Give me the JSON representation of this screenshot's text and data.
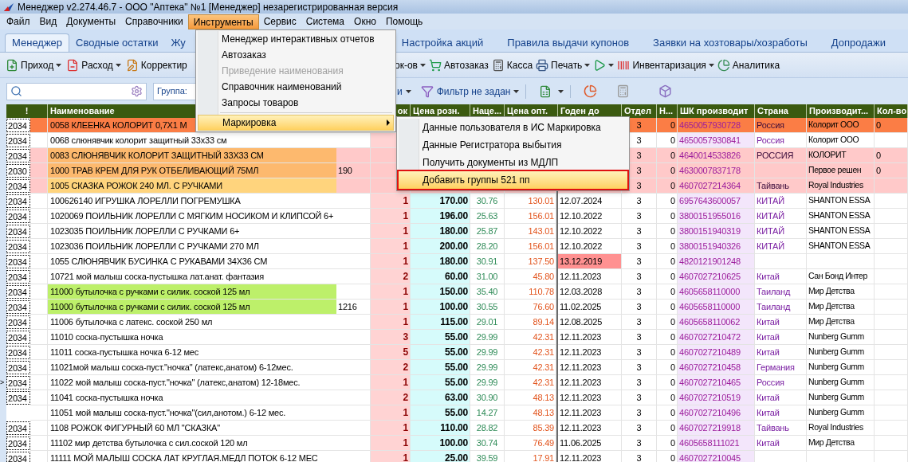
{
  "window": {
    "title": "Менеджер v2.274.46.7 - ООО \"Аптека\" №1 [Менеджер] незарегистрированная версия"
  },
  "menu_bar": [
    {
      "label": "Файл",
      "selected": false
    },
    {
      "label": "Вид",
      "selected": false
    },
    {
      "label": "Документы",
      "selected": false
    },
    {
      "label": "Справочники",
      "selected": false
    },
    {
      "label": "Инструменты",
      "selected": true
    },
    {
      "label": "Сервис",
      "selected": false
    },
    {
      "label": "Система",
      "selected": false
    },
    {
      "label": "Окно",
      "selected": false
    },
    {
      "label": "Помощь",
      "selected": false
    }
  ],
  "tabs_left": [
    {
      "label": "Менеджер",
      "selected": true
    },
    {
      "label": "Сводные остатки",
      "selected": false
    },
    {
      "label": "Жу",
      "selected": false
    }
  ],
  "tabs_right": [
    {
      "label": "Настройка акций",
      "selected": false
    },
    {
      "label": "Правила выдачи купонов",
      "selected": false
    },
    {
      "label": "Заявки на хозтовары/хозработы",
      "selected": false
    },
    {
      "label": "Допродажи",
      "selected": false
    }
  ],
  "toolbar_left": [
    {
      "label": "Приход",
      "dropdown": true
    },
    {
      "label": "Расход",
      "dropdown": true
    },
    {
      "label": "Корректир",
      "dropdown": false
    }
  ],
  "toolbar_right": [
    {
      "label": "ок-ов",
      "dropdown": true
    },
    {
      "label": "Автозаказ",
      "dropdown": false
    },
    {
      "label": "Касса",
      "dropdown": false
    },
    {
      "label": "Печать",
      "dropdown": true
    },
    {
      "dropdown": true
    },
    {
      "label": "Инвентаризация",
      "dropdown": true
    },
    {
      "label": "Аналитика",
      "dropdown": false
    }
  ],
  "filter_bar": {
    "group_label": "Группа:",
    "partial_label": "и",
    "filter_label": "Фильтр не задан"
  },
  "table": {
    "columns": [
      "!",
      "Наименование",
      "ок",
      "Цена розн.",
      "Наце...",
      "Цена опт.",
      "Годен до",
      "Отдел",
      "Н...",
      "ШК производит",
      "Страна",
      "Производит...",
      "Кол-во"
    ],
    "rows": [
      {
        "code": "2034",
        "name": {
          "text": "0058 КЛЕЕНКА КОЛОРИТ 0,7Х1 М"
        },
        "color": "#fb7d45",
        "dept": "3",
        "n": "0",
        "barcode": "4650057930728",
        "country": "Россия",
        "maker": "Колорит ООО",
        "qty": "0"
      },
      {
        "code": "2034",
        "name": {
          "text": "0068 слюнявчик колорит защитный 33х33 см"
        },
        "dept": "3",
        "n": "0",
        "barcode": "4650057930841",
        "country": "Россия",
        "maker": "Колорит ООО"
      },
      {
        "code": "2034",
        "name": {
          "text": "0083 СЛЮНЯВЧИК КОЛОРИТ ЗАЩИТНЫЙ 33Х33 СМ",
          "color": "#fdb96e"
        },
        "color": "#ffc9c9",
        "dept": "3",
        "n": "0",
        "barcode": "4640014533826",
        "country": "РОССИЯ",
        "maker": "КОЛОРИТ",
        "qty": "0"
      },
      {
        "code": "2030",
        "name": {
          "text": "1000 ТРАВ КРЕМ ДЛЯ РУК ОТБЕЛИВАЮЩИЙ 75МЛ",
          "color": "#fdb96e"
        },
        "column_3": "190",
        "color": "#ffc9c9",
        "dept": "3",
        "n": "0",
        "barcode": "4630007837178",
        "maker": "Первое решен",
        "qty": "0"
      },
      {
        "code": "2034",
        "name": {
          "text": "1005 СКАЗКА РОЖОК 240 МЛ. С РУЧКАМИ",
          "color": "#ffd47d"
        },
        "color": "#ffc9c9",
        "dept": "3",
        "n": "0",
        "barcode": "4607027214364",
        "country": "Тайвань",
        "maker": "Royal Industries"
      },
      {
        "code": "2034",
        "name": {
          "text": "100626140 ИГРУШКА ЛОРЕЛЛИ ПОГРЕМУШКА"
        },
        "stock": "1",
        "retail": "170.00",
        "markup": "30.76",
        "wholesale": "130.01",
        "expiry": "12.07.2024",
        "expired": false,
        "dept": "3",
        "n": "0",
        "barcode": "6957643600057",
        "country": "КИТАЙ",
        "maker": "SHANTON ESSA"
      },
      {
        "code": "2034",
        "name": {
          "text": "1020069 ПОИЛЬНИК ЛОРЕЛЛИ С МЯГКИМ НОСИКОМ И КЛИПСОЙ 6+"
        },
        "stock": "1",
        "retail": "196.00",
        "markup": "25.63",
        "wholesale": "156.01",
        "expiry": "12.10.2022",
        "expired": false,
        "dept": "3",
        "n": "0",
        "barcode": "3800151955016",
        "country": "КИТАЙ",
        "maker": "SHANTON ESSA"
      },
      {
        "code": "2034",
        "name": {
          "text": "1023035 ПОИЛЬНИК ЛОРЕЛЛИ С РУЧКАМИ 6+"
        },
        "stock": "1",
        "retail": "180.00",
        "markup": "25.87",
        "wholesale": "143.01",
        "expiry": "12.10.2022",
        "expired": false,
        "dept": "3",
        "n": "0",
        "barcode": "3800151940319",
        "country": "КИТАЙ",
        "maker": "SHANTON ESSA"
      },
      {
        "code": "2034",
        "name": {
          "text": "1023036 ПОИЛЬНИК ЛОРЕЛЛИ С РУЧКАМИ 270 МЛ"
        },
        "stock": "1",
        "retail": "200.00",
        "markup": "28.20",
        "wholesale": "156.01",
        "expiry": "12.10.2022",
        "expired": false,
        "dept": "3",
        "n": "0",
        "barcode": "3800151940326",
        "country": "КИТАЙ",
        "maker": "SHANTON ESSA"
      },
      {
        "code": "2034",
        "name": {
          "text": "1055 СЛЮНЯВЧИК БУСИНКА С РУКАВАМИ 34Х36 СМ"
        },
        "stock": "1",
        "retail": "180.00",
        "markup": "30.91",
        "wholesale": "137.50",
        "expiry": "13.12.2019",
        "expired": true,
        "dept": "3",
        "n": "0",
        "barcode": "4820121901248"
      },
      {
        "code": "2034",
        "name": {
          "text": "10721 мой малыш соска-пустышка лат.анат. фантазия"
        },
        "stock": "2",
        "retail": "60.00",
        "markup": "31.00",
        "wholesale": "45.80",
        "expiry": "12.11.2023",
        "expired": false,
        "dept": "3",
        "n": "0",
        "barcode": "4607027210625",
        "country": "Китай",
        "maker": "Сан Бонд Интер"
      },
      {
        "code": "2034",
        "name": {
          "text": "11000 бутылочка с ручками с силик. соской 125 мл",
          "color": "#bdf06a"
        },
        "stock": "1",
        "retail": "150.00",
        "markup": "35.40",
        "wholesale": "110.78",
        "expiry": "12.03.2028",
        "expired": false,
        "dept": "3",
        "n": "0",
        "barcode": "4605658110000",
        "country": "Таиланд",
        "maker": "Мир Детства"
      },
      {
        "code": "2034",
        "name": {
          "text": "11000 бутылочка с ручками с силик. соской 125 мл",
          "color": "#bdf06a"
        },
        "column_3": "1216",
        "stock": "1",
        "retail": "100.00",
        "markup": "30.55",
        "wholesale": "76.60",
        "expiry": "11.02.2025",
        "expired": false,
        "dept": "3",
        "n": "0",
        "barcode": "4605658110000",
        "country": "Таиланд",
        "maker": "Мир Детства"
      },
      {
        "code": "2034",
        "name": {
          "text": "11006 бутылочка с латекс. соской 250 мл"
        },
        "stock": "1",
        "retail": "115.00",
        "markup": "29.01",
        "wholesale": "89.14",
        "expiry": "12.08.2025",
        "expired": false,
        "dept": "3",
        "n": "0",
        "barcode": "4605658110062",
        "country": "Китай",
        "maker": "Мир Детства"
      },
      {
        "code": "2034",
        "name": {
          "text": "11010 соска-пустышка ночка"
        },
        "stock": "3",
        "retail": "55.00",
        "markup": "29.99",
        "wholesale": "42.31",
        "expiry": "12.11.2023",
        "expired": false,
        "dept": "3",
        "n": "0",
        "barcode": "4607027210472",
        "country": "Китай",
        "maker": "Nunberg Gumm"
      },
      {
        "code": "2034",
        "name": {
          "text": "11011 соска-пустышка ночка 6-12 мес"
        },
        "stock": "5",
        "retail": "55.00",
        "markup": "29.99",
        "wholesale": "42.31",
        "expiry": "12.11.2023",
        "expired": false,
        "dept": "3",
        "n": "0",
        "barcode": "4607027210489",
        "country": "Китай",
        "maker": "Nunberg Gumm"
      },
      {
        "code": "2034",
        "name": {
          "text": "11021мой малыш соска-пуст.\"ночка\" (латекс,анатом) 6-12мес."
        },
        "stock": "2",
        "retail": "55.00",
        "markup": "29.99",
        "wholesale": "42.31",
        "expiry": "12.11.2023",
        "expired": false,
        "dept": "3",
        "n": "0",
        "barcode": "4607027210458",
        "country": "Германия",
        "maker": "Nunberg Gumm"
      },
      {
        "marker": ">",
        "code": "2034",
        "name": {
          "text": "11022 мой малыш соска-пуст.\"ночка\" (латекс,анатом) 12-18мес."
        },
        "stock": "1",
        "retail": "55.00",
        "markup": "29.99",
        "wholesale": "42.31",
        "expiry": "12.11.2023",
        "expired": false,
        "dept": "3",
        "n": "0",
        "barcode": "4607027210465",
        "country": "Россия",
        "maker": "Nunberg Gumm"
      },
      {
        "code": "2034",
        "name": {
          "text": "11041 соска-пустышка ночка"
        },
        "stock": "2",
        "retail": "63.00",
        "markup": "30.90",
        "wholesale": "48.13",
        "expiry": "12.11.2023",
        "expired": false,
        "dept": "3",
        "n": "0",
        "barcode": "4607027210519",
        "country": "Китай",
        "maker": "Nunberg Gumm"
      },
      {
        "name": {
          "text": "11051 мой малыш соска-пуст.\"ночка\"(сил,анотом.) 6-12 мес."
        },
        "stock": "1",
        "retail": "55.00",
        "markup": "14.27",
        "wholesale": "48.13",
        "expiry": "12.11.2023",
        "expired": false,
        "dept": "3",
        "n": "0",
        "barcode": "4607027210496",
        "country": "Китай",
        "maker": "Nunberg Gumm"
      },
      {
        "code": "2034",
        "name": {
          "text": "1108 РОЖОК ФИГУРНЫЙ 60 МЛ \"СКАЗКА\""
        },
        "stock": "1",
        "retail": "110.00",
        "markup": "28.82",
        "wholesale": "85.39",
        "expiry": "12.11.2023",
        "expired": false,
        "dept": "3",
        "n": "0",
        "barcode": "4607027219918",
        "country": "Тайвань",
        "maker": "Royal Industries"
      },
      {
        "code": "2034",
        "name": {
          "text": "11102 мир детства бутылочка с сил.соской 120 мл"
        },
        "stock": "1",
        "retail": "100.00",
        "markup": "30.74",
        "wholesale": "76.49",
        "expiry": "11.06.2025",
        "expired": false,
        "dept": "3",
        "n": "0",
        "barcode": "4605658111021",
        "country": "Китай",
        "maker": "Мир Детства"
      },
      {
        "code": "2034",
        "name": {
          "text": "11111 МОЙ МАЛЫШ СОСКА ЛАТ КРУГЛАЯ.МЕДЛ ПОТОК 6-12 МЕС"
        },
        "stock": "1",
        "retail": "25.00",
        "markup": "39.59",
        "wholesale": "17.91",
        "expiry": "12.11.2023",
        "expired": false,
        "dept": "3",
        "n": "0",
        "barcode": "4607027210045"
      }
    ]
  },
  "dropdown_menu": {
    "items": [
      {
        "label": "Менеджер интерактивных отчетов",
        "disabled": false,
        "selected": false
      },
      {
        "label": "Автозаказ",
        "disabled": false,
        "selected": false
      },
      {
        "label": "Приведение наименования",
        "disabled": true,
        "selected": false
      },
      {
        "label": "Справочник наименований",
        "disabled": false,
        "selected": false
      },
      {
        "label": "Запросы товаров",
        "disabled": false,
        "selected": false
      },
      {
        "kind": "separator"
      },
      {
        "label": "Маркировка",
        "disabled": false,
        "selected": true,
        "submenu": true
      }
    ]
  },
  "submenu": {
    "items": [
      {
        "label": "Данные пользователя в ИС Маркировка",
        "selected": false,
        "outlined": false
      },
      {
        "label": "Данные Регистратора выбытия",
        "selected": false,
        "outlined": false
      },
      {
        "label": "Получить документы из МДЛП",
        "selected": false,
        "outlined": false
      },
      {
        "label": "Добавить группы 521 пп",
        "selected": true,
        "outlined": true
      }
    ]
  }
}
